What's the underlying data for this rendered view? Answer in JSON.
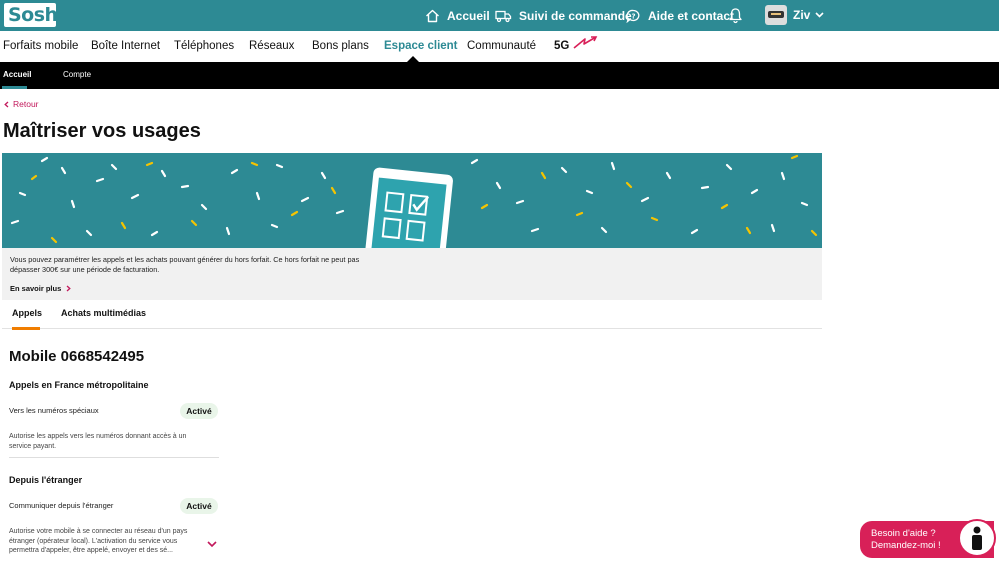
{
  "brand": {
    "logo_text": "Sosh",
    "accent": "#2d8a94",
    "highlight": "#d82058",
    "tab_accent": "#f07d00"
  },
  "topbar": {
    "links": [
      {
        "label": "Accueil",
        "icon": "home-icon"
      },
      {
        "label": "Suivi de commande",
        "icon": "truck-icon"
      },
      {
        "label": "Aide et contact",
        "icon": "help-bubble-icon"
      }
    ],
    "bell_icon": "bell-icon",
    "user_name": "Ziv"
  },
  "mainnav": {
    "items": [
      "Forfaits mobile",
      "Boîte Internet",
      "Téléphones",
      "Réseaux",
      "Bons plans",
      "Espace client",
      "Communauté",
      "5G"
    ],
    "active": "Espace client"
  },
  "subnav": {
    "items": [
      "Accueil",
      "Compte"
    ],
    "active": "Accueil"
  },
  "back_label": "Retour",
  "page_title": "Maîtriser vos usages",
  "info": {
    "text": "Vous pouvez paramétrer les appels et les achats pouvant générer du hors forfait. Ce hors forfait ne peut pas dépasser 300€ sur une période de facturation.",
    "link": "En savoir plus"
  },
  "tabs": {
    "items": [
      "Appels",
      "Achats multimédias"
    ],
    "active": "Appels"
  },
  "mobile_title": "Mobile 0668542495",
  "sections": [
    {
      "title": "Appels en France métropolitaine",
      "label": "Vers les numéros spéciaux",
      "status": "Activé",
      "description": "Autorise les appels vers les numéros donnant accès à un service payant."
    },
    {
      "title": "Depuis l'étranger",
      "label": "Communiquer depuis l'étranger",
      "status": "Activé",
      "description": "Autorise votre mobile à se connecter au réseau d'un pays étranger (opérateur local). L'activation du service vous permettra d'appeler, être appelé, envoyer et des sé..."
    }
  ],
  "help": {
    "line1": "Besoin d'aide ?",
    "line2": "Demandez-moi !"
  }
}
